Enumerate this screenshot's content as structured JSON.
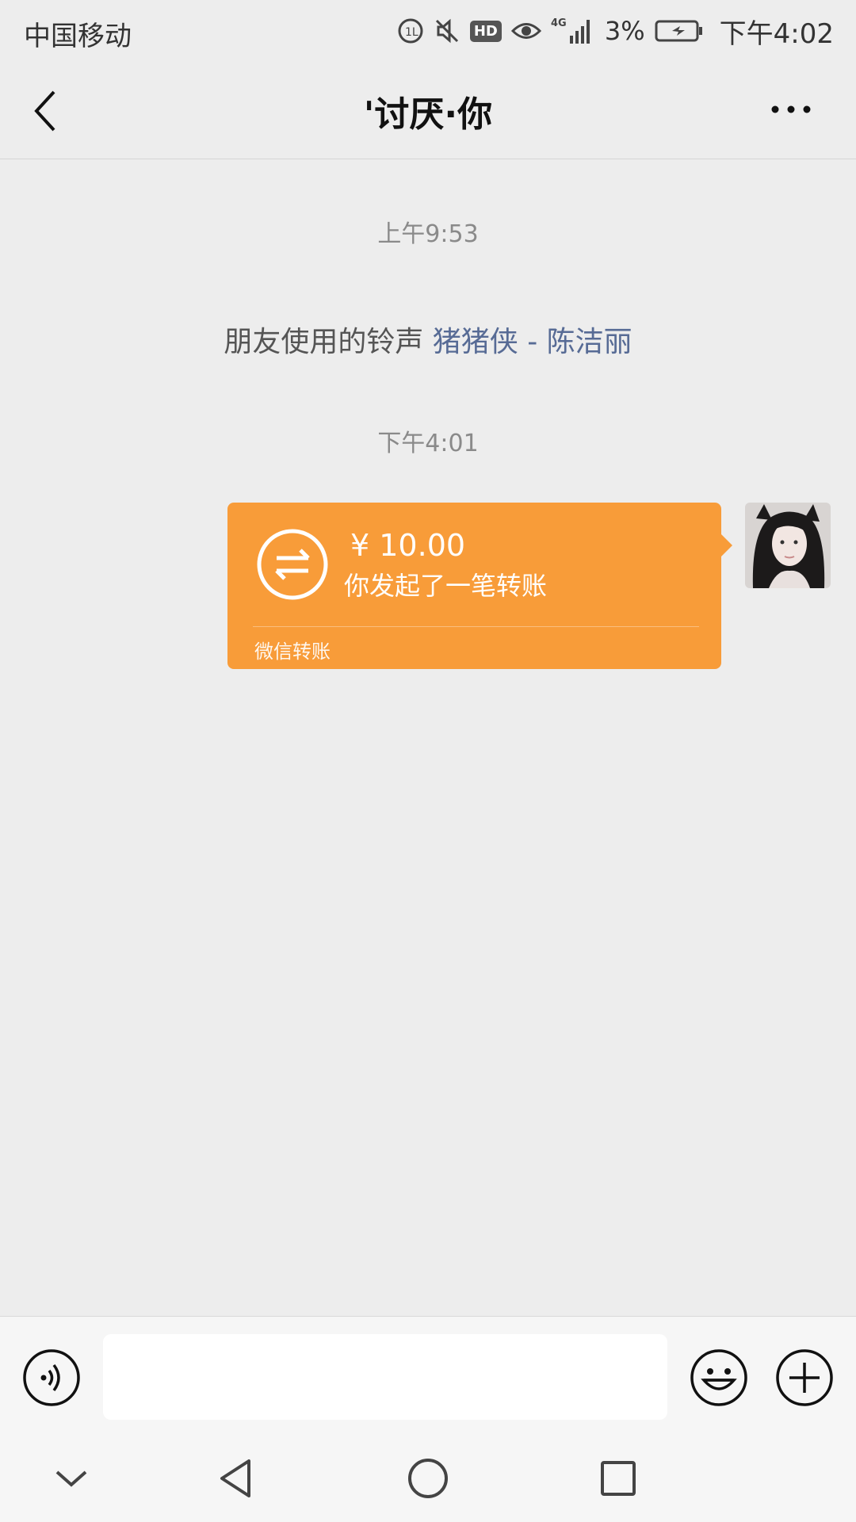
{
  "status_bar": {
    "carrier": "中国移动",
    "network": "4G",
    "hd_badge": "HD",
    "battery": "3%",
    "time": "下午4:02"
  },
  "nav": {
    "title": "'讨厌·你"
  },
  "chat": {
    "time1": "上午9:53",
    "system_note_prefix": "朋友使用的铃声 ",
    "system_note_link": "猪猪侠 - 陈洁丽",
    "time2": "下午4:01",
    "transfer": {
      "amount": "¥ 10.00",
      "description": "你发起了一笔转账",
      "footer": "微信转账",
      "color": "#f89c39"
    }
  },
  "input_bar": {
    "placeholder": ""
  },
  "colors": {
    "background": "#ededed",
    "link": "#576b95",
    "transfer": "#f89c39"
  },
  "icons": [
    "back-arrow-icon",
    "more-icon",
    "voice-icon",
    "emoji-icon",
    "plus-icon",
    "transfer-arrows-icon",
    "nav-hide-icon",
    "nav-back-icon",
    "nav-home-icon",
    "nav-recent-icon"
  ]
}
